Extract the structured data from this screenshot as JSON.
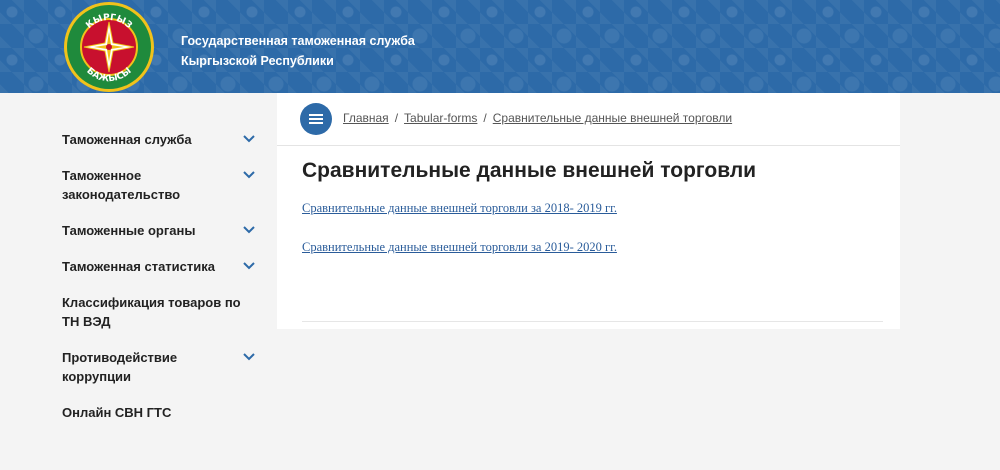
{
  "header": {
    "logo_text_top": "КЫРГЫЗ",
    "logo_text_bottom": "БАЖЫСЫ",
    "title_line1": "Государственная таможенная служба",
    "title_line2": "Кыргызской Республики",
    "color": "#2d6aa8"
  },
  "sidebar": {
    "items": [
      {
        "label": "Таможенная служба",
        "has_submenu": true
      },
      {
        "label": "Таможенное законодательство",
        "has_submenu": true
      },
      {
        "label": "Таможенные органы",
        "has_submenu": true
      },
      {
        "label": "Таможенная статистика",
        "has_submenu": true
      },
      {
        "label": "Классификация товаров по ТН ВЭД",
        "has_submenu": false
      },
      {
        "label": "Противодействие коррупции",
        "has_submenu": true
      },
      {
        "label": "Онлайн СВН ГТС",
        "has_submenu": false
      }
    ]
  },
  "breadcrumb": {
    "items": [
      "Главная",
      "Tabular-forms",
      "Сравнительные данные внешней торговли"
    ],
    "separator": "/"
  },
  "main": {
    "title": "Сравнительные данные внешней торговли",
    "links": [
      "Сравнительные данные внешней торговли за 2018- 2019 гг.",
      "Сравнительные данные внешней торговли за 2019- 2020 гг."
    ]
  },
  "icons": {
    "menu": "hamburger-icon",
    "chevron": "chevron-down-icon"
  }
}
